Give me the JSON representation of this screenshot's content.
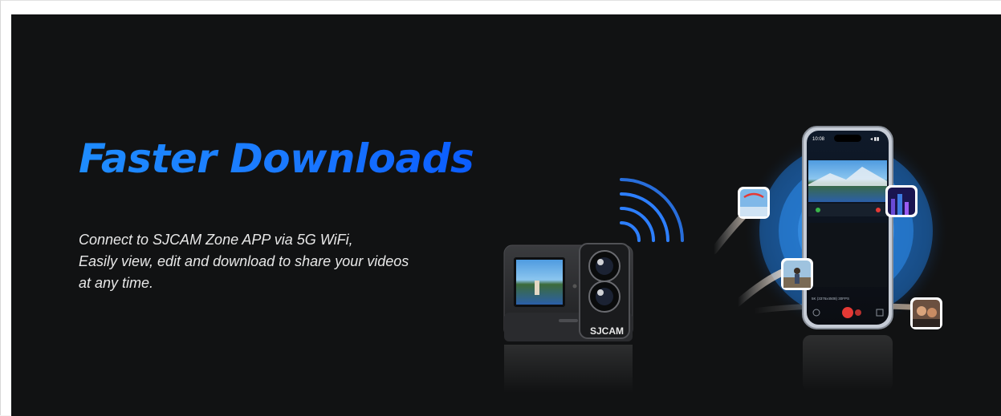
{
  "banner": {
    "headline": "Faster Downloads",
    "copy_lines": [
      "Connect to SJCAM Zone APP via 5G WiFi,",
      "Easily view, edit and download to share your videos",
      "at any time."
    ]
  },
  "camera": {
    "brand_label": "SJCAM",
    "icon": "wifi-signal-icon"
  },
  "phone": {
    "status_time": "10:08",
    "status_icons": "◂ ▮▮",
    "resolution_readout": "5K (3376x4508) 30FPS"
  },
  "colors": {
    "background": "#111213",
    "headline_blue": "#1a7cff",
    "ring_blue": "#1f7ad6",
    "text": "#e8e8e8"
  }
}
